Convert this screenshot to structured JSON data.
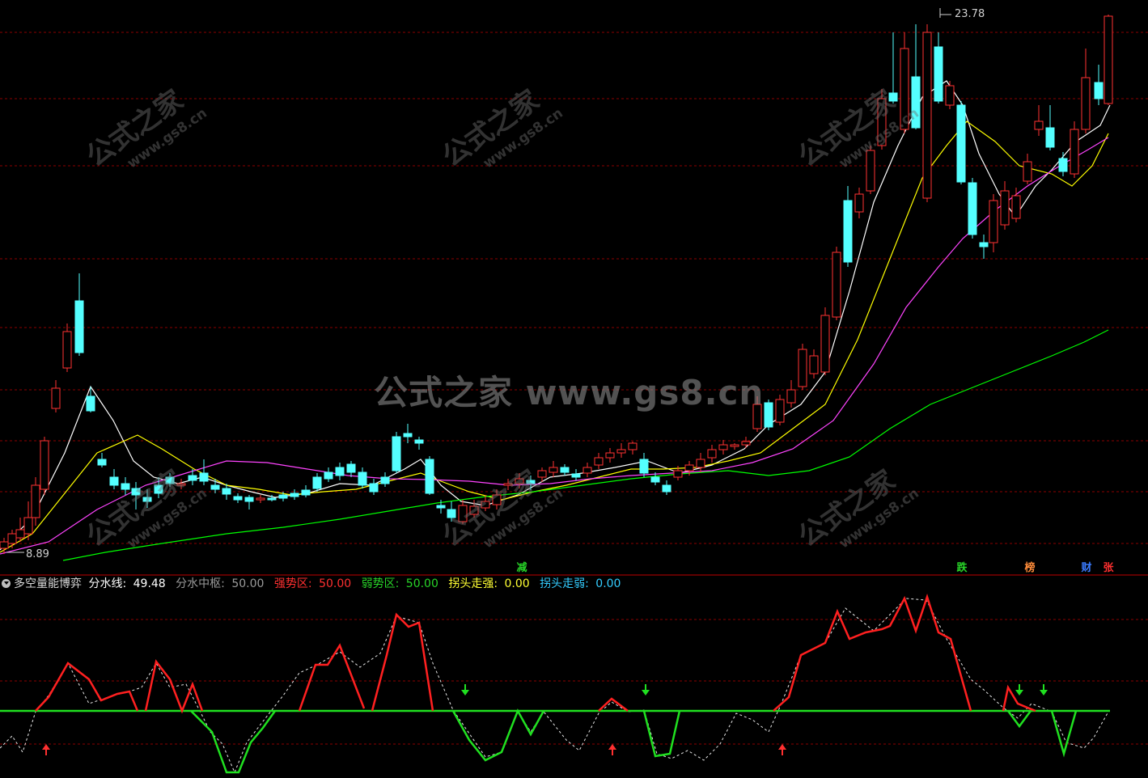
{
  "price_panel": {
    "high_label": "23.78",
    "low_label": "8.89"
  },
  "tags": [
    {
      "label": "减",
      "color": "#28d428"
    },
    {
      "label": "跌",
      "color": "#28d428"
    },
    {
      "label": "榜",
      "color": "#ff8c3a"
    },
    {
      "label": "财",
      "color": "#3a7bff"
    },
    {
      "label": "张",
      "color": "#ff3030"
    }
  ],
  "indicator": {
    "name": "多空量能博弈",
    "fields": [
      {
        "label": "分水线:",
        "value": "49.48",
        "color": "#ffffff"
      },
      {
        "label": "分水中枢:",
        "value": "50.00",
        "color": "#9a9a9a"
      },
      {
        "label": "强势区:",
        "value": "50.00",
        "color": "#ff3030"
      },
      {
        "label": "弱势区:",
        "value": "50.00",
        "color": "#28d428"
      },
      {
        "label": "拐头走强:",
        "value": "0.00",
        "color": "#ffff33"
      },
      {
        "label": "拐头走弱:",
        "value": "0.00",
        "color": "#33ccff"
      }
    ]
  },
  "watermark": {
    "center": "公式之家 www.gs8.cn",
    "diag_big": "公式之家",
    "diag_small": "www.gs8.cn"
  },
  "colors": {
    "up": "#ff3232",
    "down": "#54ffff",
    "ma5": "#ffffff",
    "ma10": "#ffff00",
    "ma20": "#ff44ff",
    "ma60": "#00ff00",
    "grid": "#8b0000",
    "strong": "#ff2020",
    "weak": "#20e020"
  },
  "chart_data": {
    "type": "candlestick",
    "price_range": [
      8.0,
      24.5
    ],
    "high": 23.78,
    "low": 8.89
  }
}
